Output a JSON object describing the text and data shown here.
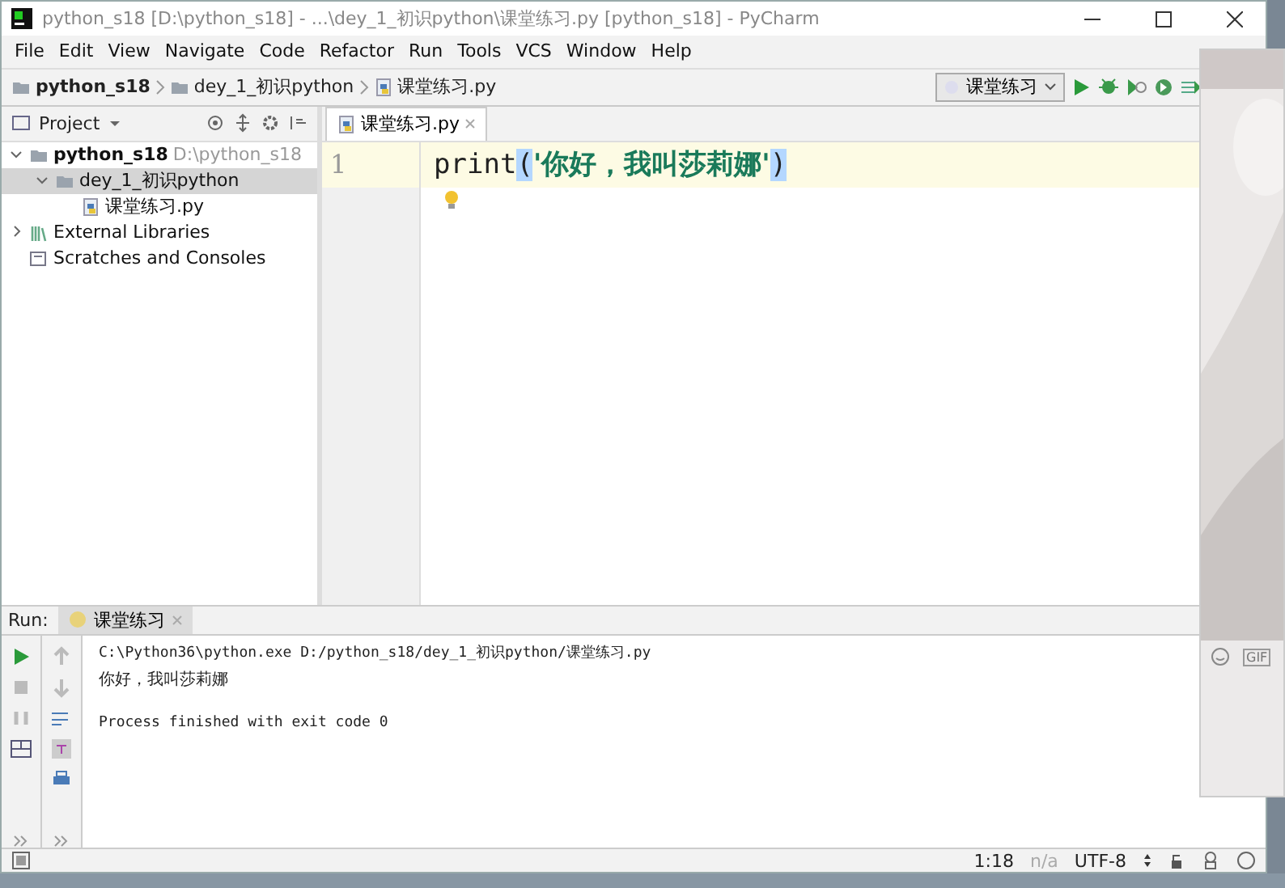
{
  "window": {
    "title": "python_s18 [D:\\python_s18] - ...\\dey_1_初识python\\课堂练习.py [python_s18] - PyCharm"
  },
  "menu": [
    {
      "label": "File"
    },
    {
      "label": "Edit"
    },
    {
      "label": "View"
    },
    {
      "label": "Navigate"
    },
    {
      "label": "Code"
    },
    {
      "label": "Refactor"
    },
    {
      "label": "Run"
    },
    {
      "label": "Tools"
    },
    {
      "label": "VCS"
    },
    {
      "label": "Window"
    },
    {
      "label": "Help"
    }
  ],
  "breadcrumbs": [
    {
      "label": "python_s18",
      "kind": "project"
    },
    {
      "label": "dey_1_初识python",
      "kind": "folder"
    },
    {
      "label": "课堂练习.py",
      "kind": "file"
    }
  ],
  "run_config": {
    "label": "课堂练习"
  },
  "project_panel": {
    "title": "Project",
    "tree": [
      {
        "label": "python_s18",
        "path": "D:\\python_s18",
        "kind": "project",
        "expanded": true,
        "selected": false,
        "children": [
          {
            "label": "dey_1_初识python",
            "kind": "folder",
            "expanded": true,
            "selected": true,
            "children": [
              {
                "label": "课堂练习.py",
                "kind": "file",
                "selected": false
              }
            ]
          }
        ]
      },
      {
        "label": "External Libraries",
        "kind": "library",
        "expanded": false,
        "selected": false
      },
      {
        "label": "Scratches and Consoles",
        "kind": "scratch",
        "selected": false
      }
    ]
  },
  "editor": {
    "tabs": [
      {
        "label": "课堂练习.py",
        "selected": true
      }
    ],
    "lines": [
      {
        "number": "1",
        "current": true,
        "tokens": [
          {
            "text": "print",
            "kind": "plain",
            "matched": false
          },
          {
            "text": "(",
            "kind": "brace",
            "matched": true
          },
          {
            "text": "'你好，我叫莎莉娜'",
            "kind": "string",
            "matched": false
          },
          {
            "text": ")",
            "kind": "brace",
            "matched": true
          }
        ]
      }
    ]
  },
  "run_panel": {
    "label": "Run:",
    "tabs": [
      {
        "label": "课堂练习",
        "selected": true
      }
    ],
    "output": [
      {
        "text": "C:\\Python36\\python.exe D:/python_s18/dey_1_初识python/课堂练习.py",
        "kind": "command"
      },
      {
        "text": "你好，我叫莎莉娜",
        "kind": "stdout"
      },
      {
        "text": "Process finished with exit code 0",
        "kind": "system"
      }
    ]
  },
  "status_bar": {
    "position": "1:18",
    "line_separator": "n/a",
    "encoding": "UTF-8"
  },
  "overlay": {
    "gif_label": "GIF"
  }
}
